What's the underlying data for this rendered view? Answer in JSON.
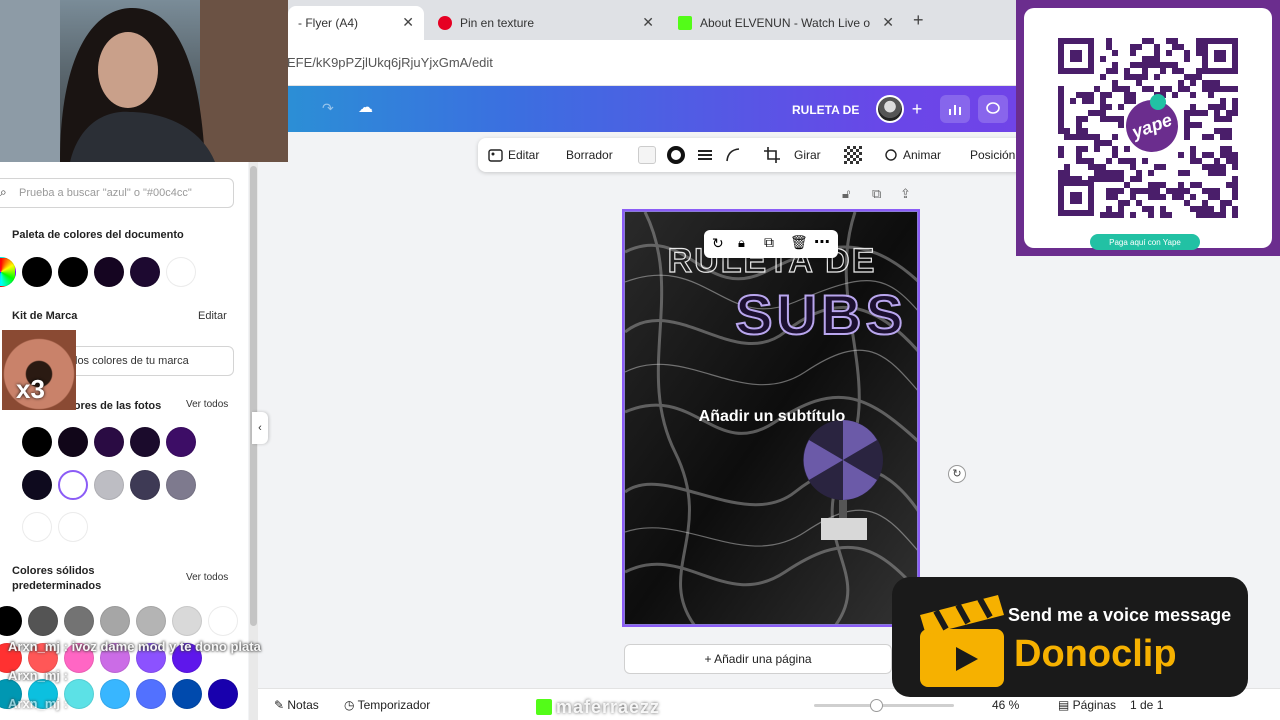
{
  "browser": {
    "tabs": [
      {
        "label": "- Flyer (A4)"
      },
      {
        "label": "Pin en texture"
      },
      {
        "label": "About ELVENUN - Watch Live o"
      }
    ],
    "address": "EFE/kK9pPZjlUkq6jRjuYjxGmA/edit"
  },
  "header": {
    "title": "RULETA DE"
  },
  "toolbar": {
    "edit": "Editar",
    "eraser": "Borrador",
    "rotate": "Girar",
    "animate": "Animar",
    "position": "Posición"
  },
  "panel": {
    "search_placeholder": "Prueba a buscar \"azul\" o \"#00c4cc\"",
    "doc_palette_title": "Paleta de colores del documento",
    "doc_palette": [
      "#000000",
      "#000000",
      "#150521",
      "#1d0930",
      "#ffffff"
    ],
    "brand_kit_title": "Kit de Marca",
    "brand_kit_edit": "Editar",
    "brand_input_text": "los colores de tu marca",
    "photo_colors_title": "de colores de las fotos",
    "photo_colors_see_all": "Ver todos",
    "photo_colors_row1": [
      "#000000",
      "#110619",
      "#2a0b43",
      "#1b0b2c",
      "#3d0d66"
    ],
    "photo_colors_row2": [
      "#0e0a1e",
      "#ffffff",
      "#bdbdc3",
      "#3e3a55",
      "#7e7a8e"
    ],
    "photo_colors_row3": [
      "#ffffff",
      "#ffffff"
    ],
    "solid_title": "Colores sólidos predeterminados",
    "solid_see_all": "Ver todos",
    "solid_row1": [
      "#000000",
      "#545454",
      "#737373",
      "#a6a6a6",
      "#b4b4b4",
      "#d9d9d9",
      "#ffffff"
    ],
    "solid_row2": [
      "#ff3131",
      "#ff5757",
      "#ff66c4",
      "#cb6ce6",
      "#8c52ff",
      "#5e17eb"
    ],
    "solid_row3": [
      "#0097b2",
      "#0cc0df",
      "#5ce1e6",
      "#38b6ff",
      "#5271ff",
      "#004aad",
      "#1800ad"
    ]
  },
  "canvas": {
    "title_line1": "RULETA DE",
    "title_line2": "SUBS",
    "subtitle": "Añadir un subtítulo",
    "add_page": "+ Añadir una página"
  },
  "bottombar": {
    "notes": "Notas",
    "timer": "Temporizador",
    "zoom": "46 %",
    "pages_label": "Páginas",
    "pages_value": "1 de 1"
  },
  "overlays": {
    "chat1": "Arxn_mj : ivoz dame mod y te dono plata",
    "chat2": "Arxn_mj :",
    "chat3": "Arxn_mj :",
    "watermark": "maferraezz",
    "sticker": "x3",
    "yape_button": "Paga aquí con Yape",
    "yape_logo": "yape",
    "donoclip_line1": "Send me a voice message",
    "donoclip_line2": "Donoclip"
  }
}
